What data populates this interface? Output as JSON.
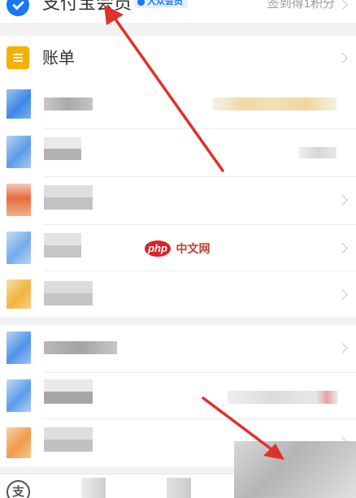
{
  "header": {
    "title": "支付宝会员",
    "badge": "大众会员",
    "signin": "签到得1积分",
    "icon": "member-check-icon"
  },
  "bill": {
    "label": "账单",
    "icon": "bill-list-icon"
  },
  "bottom": {
    "icon_text": "支",
    "icon": "alipay-logo-icon"
  },
  "watermark": {
    "logo": "php",
    "text": "中文网"
  },
  "colors": {
    "brand_blue": "#1677ff",
    "bill_orange": "#f5b000",
    "arrow_red": "#e0302a"
  }
}
